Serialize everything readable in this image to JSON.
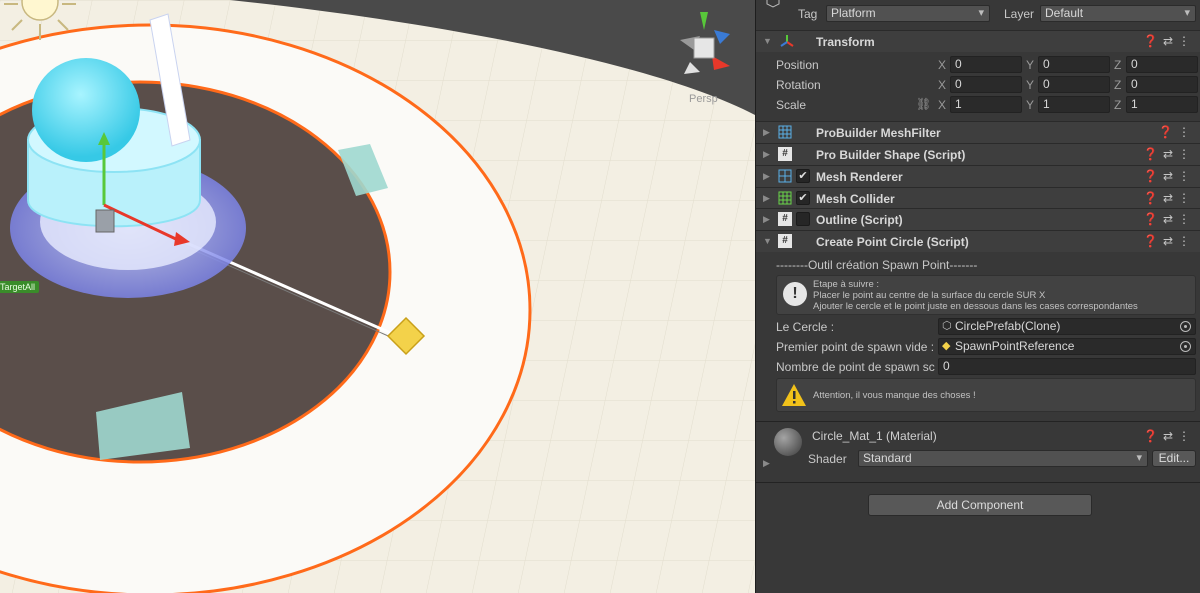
{
  "scene": {
    "persp_label": "Persp",
    "target_tag": "TargetAll"
  },
  "inspector": {
    "tag_label": "Tag",
    "tag_value": "Platform",
    "layer_label": "Layer",
    "layer_value": "Default",
    "transform": {
      "title": "Transform",
      "position": {
        "label": "Position",
        "x": "0",
        "y": "0",
        "z": "0"
      },
      "rotation": {
        "label": "Rotation",
        "x": "0",
        "y": "0",
        "z": "0"
      },
      "scale": {
        "label": "Scale",
        "x": "1",
        "y": "1",
        "z": "1"
      },
      "axis_x": "X",
      "axis_y": "Y",
      "axis_z": "Z"
    },
    "components": [
      {
        "title": "ProBuilder MeshFilter"
      },
      {
        "title": "Pro Builder Shape (Script)"
      },
      {
        "title": "Mesh Renderer"
      },
      {
        "title": "Mesh Collider"
      },
      {
        "title": "Outline (Script)"
      },
      {
        "title": "Create Point Circle (Script)"
      }
    ],
    "script": {
      "section_title": "--------Outil création Spawn Point-------",
      "help_line1": "Etape à suivre :",
      "help_line2": "Placer le point au centre de la surface du cercle SUR X",
      "help_line3": "Ajouter le cercle et le point juste en dessous dans les cases correspondantes",
      "circle_label": "Le Cercle :",
      "circle_value": "CirclePrefab(Clone)",
      "spawn_label": "Premier point de spawn vide :",
      "spawn_value": "SpawnPointReference",
      "count_label": "Nombre de point de spawn sc",
      "count_value": "0",
      "warning": "Attention, il vous manque des choses !"
    },
    "material": {
      "title": "Circle_Mat_1 (Material)",
      "shader_label": "Shader",
      "shader_value": "Standard",
      "edit_label": "Edit..."
    },
    "add_component": "Add Component"
  }
}
